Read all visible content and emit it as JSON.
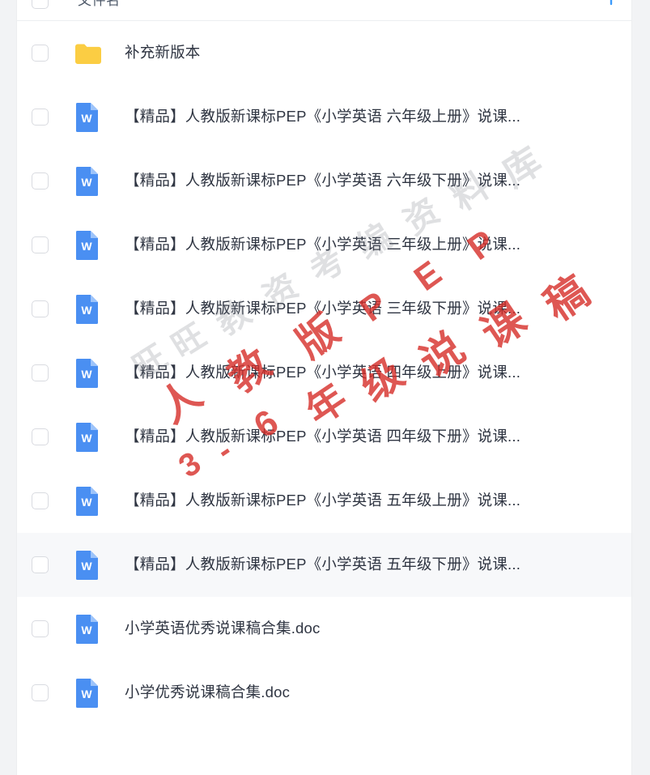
{
  "header": {
    "column_label": "文件名",
    "sort_icon": "sort-ascending-arrow-icon",
    "sort_icon_color": "#3d9bfb"
  },
  "colors": {
    "folder": "#fbcd43",
    "word_icon": "#4a8ff2",
    "page_bg": "#f2f3f5",
    "panel_bg": "#ffffff",
    "row_highlight": "#f7f8fa",
    "text": "#2f3542",
    "header_text": "#4e5969",
    "watermark_red": "#d62d28",
    "watermark_gray": "#787c86"
  },
  "rows": [
    {
      "type": "folder",
      "icon": "folder-icon",
      "name": "补充新版本",
      "highlight": false
    },
    {
      "type": "document",
      "icon": "word-file-icon",
      "name": "【精品】人教版新课标PEP《小学英语 六年级上册》说课...",
      "highlight": false
    },
    {
      "type": "document",
      "icon": "word-file-icon",
      "name": "【精品】人教版新课标PEP《小学英语 六年级下册》说课...",
      "highlight": false
    },
    {
      "type": "document",
      "icon": "word-file-icon",
      "name": "【精品】人教版新课标PEP《小学英语 三年级上册》说课...",
      "highlight": false
    },
    {
      "type": "document",
      "icon": "word-file-icon",
      "name": "【精品】人教版新课标PEP《小学英语 三年级下册》说课...",
      "highlight": false
    },
    {
      "type": "document",
      "icon": "word-file-icon",
      "name": "【精品】人教版新课标PEP《小学英语 四年级上册》说课...",
      "highlight": false
    },
    {
      "type": "document",
      "icon": "word-file-icon",
      "name": "【精品】人教版新课标PEP《小学英语 四年级下册》说课...",
      "highlight": false
    },
    {
      "type": "document",
      "icon": "word-file-icon",
      "name": "【精品】人教版新课标PEP《小学英语 五年级上册》说课...",
      "highlight": false
    },
    {
      "type": "document",
      "icon": "word-file-icon",
      "name": "【精品】人教版新课标PEP《小学英语 五年级下册》说课...",
      "highlight": true
    },
    {
      "type": "document",
      "icon": "word-file-icon",
      "name": "小学英语优秀说课稿合集.doc",
      "highlight": false
    },
    {
      "type": "document",
      "icon": "word-file-icon",
      "name": "小学优秀说课稿合集.doc",
      "highlight": false
    }
  ],
  "watermarks": {
    "gray_text": "旺旺教资考编资料库",
    "gray_chars": [
      "旺",
      "旺",
      "教",
      "资",
      "考",
      "编",
      "资",
      "料",
      "库"
    ],
    "red_text": "人教版PEP 3-6年级说课稿",
    "red_chars": [
      "人",
      "教",
      "版",
      "P",
      "E",
      "P"
    ],
    "red_chars_line2": [
      "3",
      "-",
      "6",
      "年",
      "级",
      "说",
      "课",
      "稿"
    ]
  }
}
